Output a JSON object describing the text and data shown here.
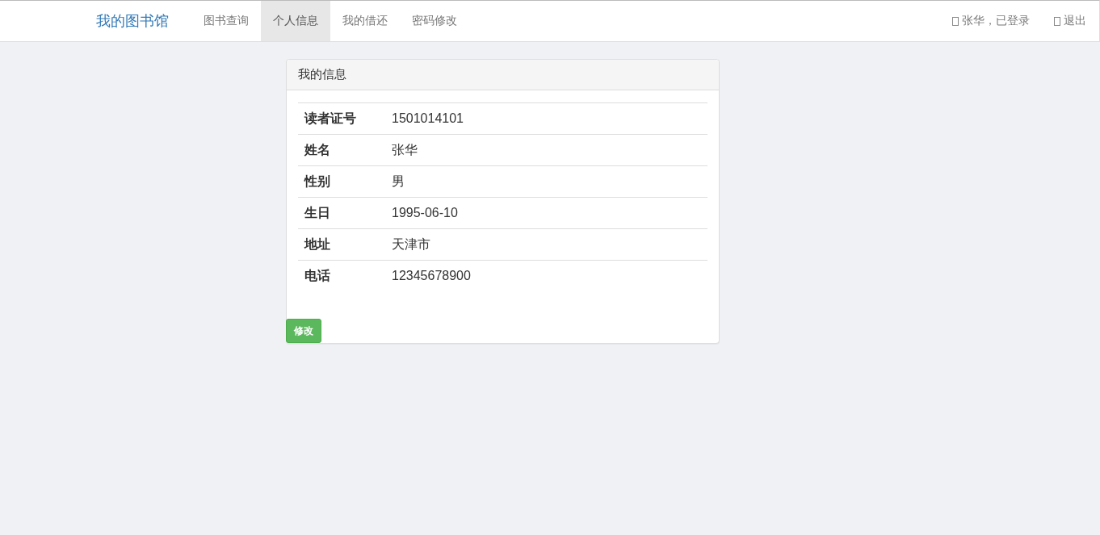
{
  "navbar": {
    "brand": "我的图书馆",
    "nav_items": [
      {
        "label": "图书查询",
        "selected": false
      },
      {
        "label": "个人信息",
        "selected": true
      },
      {
        "label": "我的借还",
        "selected": false
      },
      {
        "label": "密码修改",
        "selected": false
      }
    ],
    "user_status": "张华，已登录",
    "logout": "退出"
  },
  "panel": {
    "title": "我的信息",
    "rows": [
      {
        "label": "读者证号",
        "value": "1501014101"
      },
      {
        "label": "姓名",
        "value": "张华"
      },
      {
        "label": "性别",
        "value": "男"
      },
      {
        "label": "生日",
        "value": "1995-06-10"
      },
      {
        "label": "地址",
        "value": "天津市"
      },
      {
        "label": "电话",
        "value": "12345678900"
      }
    ],
    "edit_button": "修改"
  }
}
